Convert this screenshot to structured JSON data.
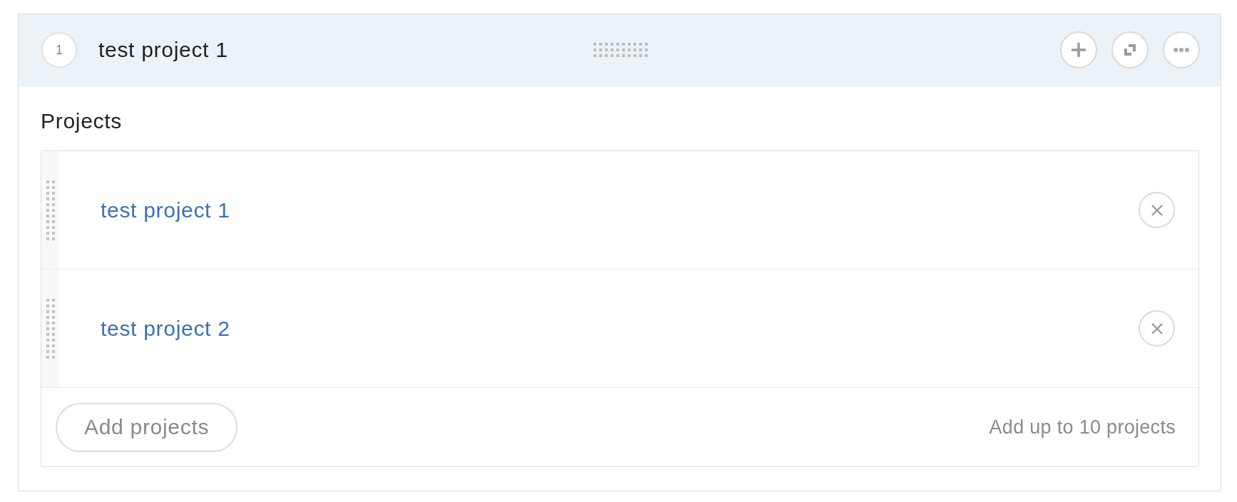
{
  "block": {
    "number": "1",
    "title": "test project 1"
  },
  "field": {
    "label": "Projects",
    "items": [
      {
        "title": "test project 1"
      },
      {
        "title": "test project 2"
      }
    ],
    "add_button": "Add projects",
    "limit_note": "Add up to 10 projects"
  }
}
